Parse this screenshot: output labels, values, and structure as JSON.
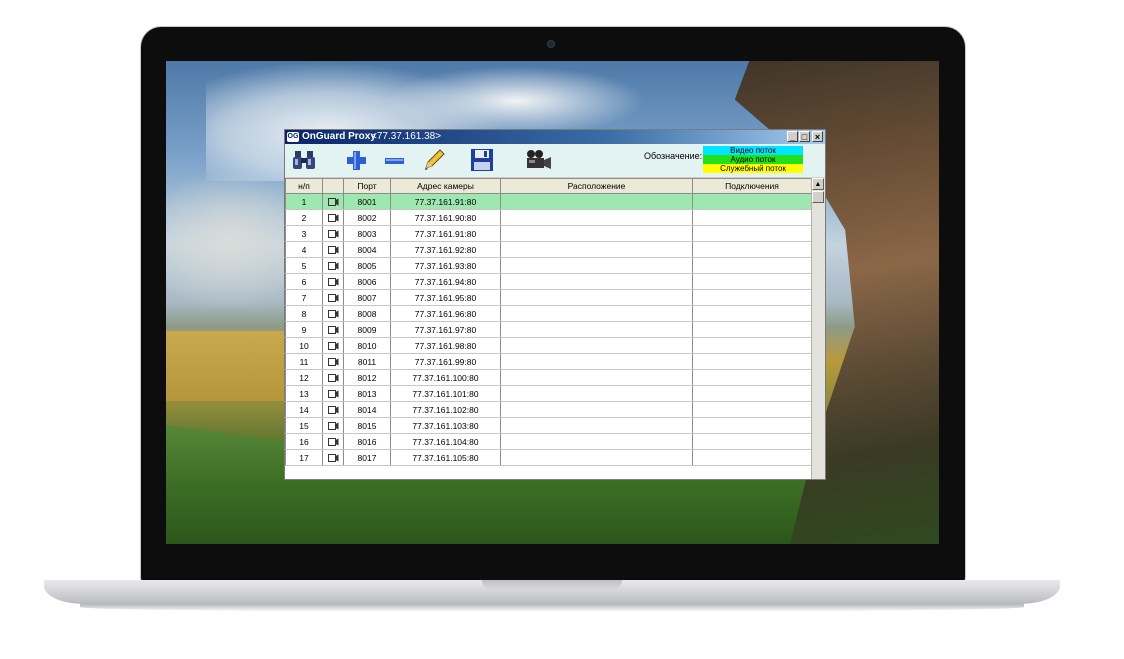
{
  "window": {
    "app_icon_text": "OG",
    "title": "OnGuard Proxy",
    "address": "<77.37.161.38>",
    "controls": {
      "minimize": "_",
      "maximize": "□",
      "close": "×"
    }
  },
  "toolbar": {
    "tools": [
      "binoculars-icon",
      "plus-icon",
      "minus-icon",
      "pencil-icon",
      "floppy-disk-icon",
      "video-camera-icon"
    ],
    "legend_label": "Обозначение:",
    "legend": [
      {
        "label": "Видео поток",
        "color": "#00e5ff"
      },
      {
        "label": "Аудио поток",
        "color": "#22e01a"
      },
      {
        "label": "Служебный поток",
        "color": "#ffff00"
      }
    ]
  },
  "table": {
    "columns": [
      "н/п",
      "",
      "Порт",
      "Адрес камеры",
      "Расположение",
      "Подключения"
    ],
    "selected_row": 0,
    "selected_color": "#9fe7b0",
    "rows": [
      {
        "n": "1",
        "port": "8001",
        "address": "77.37.161.91:80",
        "location": "",
        "connections": ""
      },
      {
        "n": "2",
        "port": "8002",
        "address": "77.37.161.90:80",
        "location": "",
        "connections": ""
      },
      {
        "n": "3",
        "port": "8003",
        "address": "77.37.161.91:80",
        "location": "",
        "connections": ""
      },
      {
        "n": "4",
        "port": "8004",
        "address": "77.37.161.92:80",
        "location": "",
        "connections": ""
      },
      {
        "n": "5",
        "port": "8005",
        "address": "77.37.161.93:80",
        "location": "",
        "connections": ""
      },
      {
        "n": "6",
        "port": "8006",
        "address": "77.37.161.94:80",
        "location": "",
        "connections": ""
      },
      {
        "n": "7",
        "port": "8007",
        "address": "77.37.161.95:80",
        "location": "",
        "connections": ""
      },
      {
        "n": "8",
        "port": "8008",
        "address": "77.37.161.96:80",
        "location": "",
        "connections": ""
      },
      {
        "n": "9",
        "port": "8009",
        "address": "77.37.161.97:80",
        "location": "",
        "connections": ""
      },
      {
        "n": "10",
        "port": "8010",
        "address": "77.37.161.98:80",
        "location": "",
        "connections": ""
      },
      {
        "n": "11",
        "port": "8011",
        "address": "77.37.161.99:80",
        "location": "",
        "connections": ""
      },
      {
        "n": "12",
        "port": "8012",
        "address": "77.37.161.100:80",
        "location": "",
        "connections": ""
      },
      {
        "n": "13",
        "port": "8013",
        "address": "77.37.161.101:80",
        "location": "",
        "connections": ""
      },
      {
        "n": "14",
        "port": "8014",
        "address": "77.37.161.102:80",
        "location": "",
        "connections": ""
      },
      {
        "n": "15",
        "port": "8015",
        "address": "77.37.161.103:80",
        "location": "",
        "connections": ""
      },
      {
        "n": "16",
        "port": "8016",
        "address": "77.37.161.104:80",
        "location": "",
        "connections": ""
      },
      {
        "n": "17",
        "port": "8017",
        "address": "77.37.161.105:80",
        "location": "",
        "connections": ""
      }
    ]
  }
}
